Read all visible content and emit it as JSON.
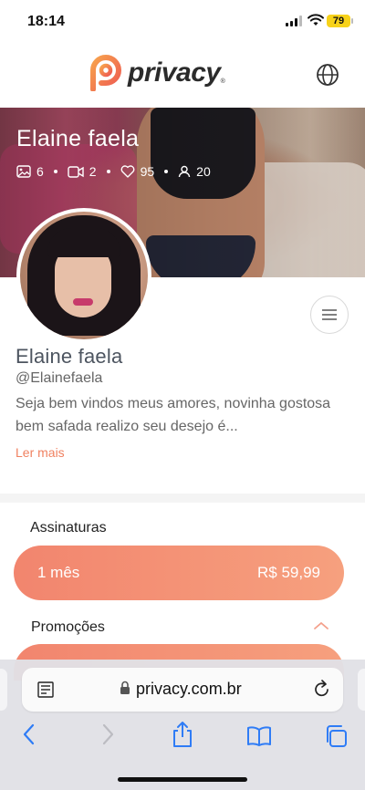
{
  "status": {
    "time": "18:14",
    "battery": "79"
  },
  "header": {
    "logo_text": "privacy",
    "logo_reg": "®",
    "globe_icon": "globe-icon"
  },
  "cover": {
    "name": "Elaine faela",
    "stats": {
      "photos": "6",
      "videos": "2",
      "likes": "95",
      "subscribers": "20"
    }
  },
  "profile": {
    "name": "Elaine faela",
    "handle": "@Elainefaela",
    "bio": "Seja bem vindos meus amores, novinha gostosa bem safada realizo seu desejo é...",
    "read_more": "Ler mais"
  },
  "subscriptions": {
    "title": "Assinaturas",
    "plan_label": "1 mês",
    "plan_price": "R$ 59,99"
  },
  "promotions": {
    "title": "Promoções"
  },
  "browser": {
    "url": "privacy.com.br"
  },
  "colors": {
    "brand": "#f08261",
    "button_start": "#f2856e",
    "button_end": "#f6a07e",
    "safari_blue": "#2f7cf6"
  }
}
